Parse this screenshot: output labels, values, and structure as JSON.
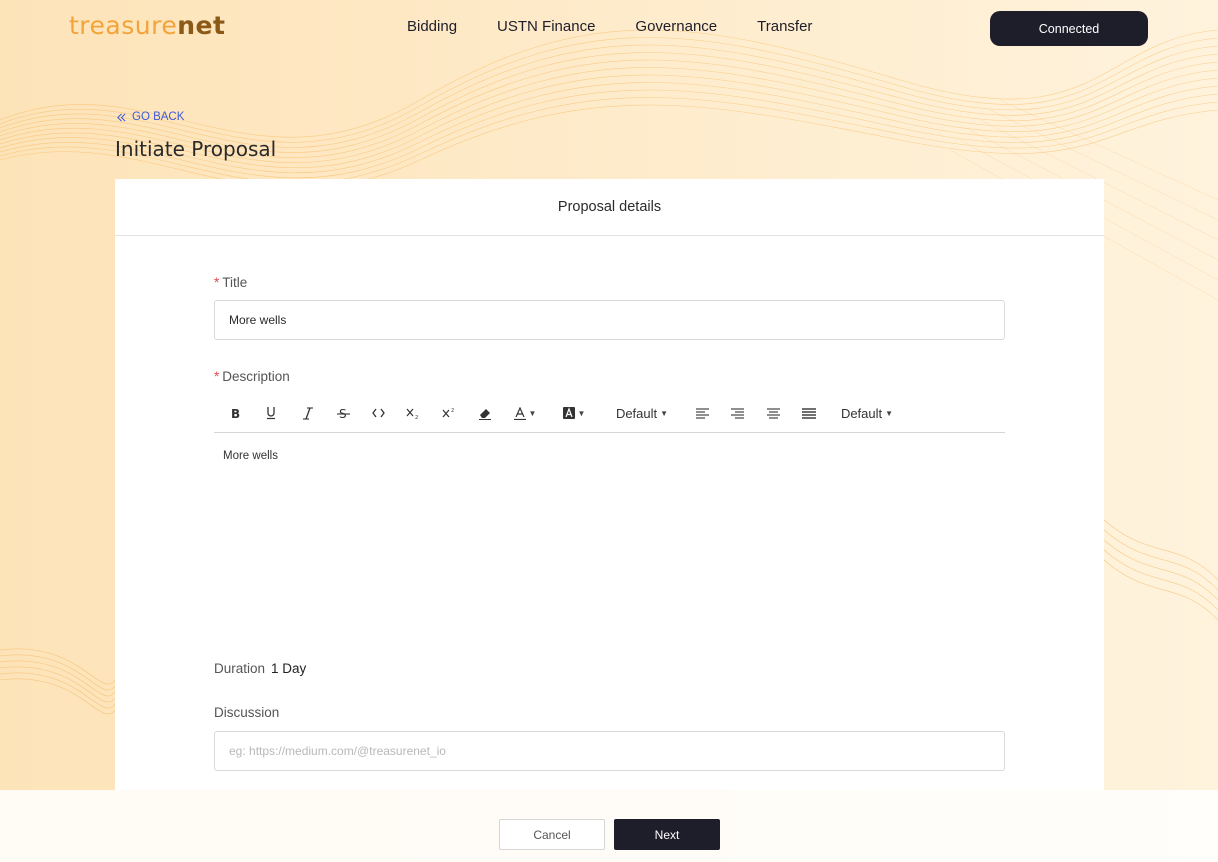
{
  "header": {
    "logo_light": "treasure",
    "logo_dark": "net",
    "nav": [
      "Bidding",
      "USTN Finance",
      "Governance",
      "Transfer"
    ],
    "connect_label": "Connected"
  },
  "page": {
    "back_label": "GO BACK",
    "title": "Initiate Proposal"
  },
  "card": {
    "heading": "Proposal details",
    "title_label": "Title",
    "title_value": "More wells",
    "description_label": "Description",
    "toolbar": {
      "font_size": "Default",
      "line_height": "Default",
      "tools": [
        "bold-icon",
        "underline-icon",
        "italic-icon",
        "strikethrough-icon",
        "code-icon",
        "subscript-icon",
        "superscript-icon",
        "eraser-icon",
        "text-color-icon",
        "highlight-icon",
        "align-left-icon",
        "align-right-icon",
        "align-center-icon",
        "align-justify-icon"
      ]
    },
    "description_value": "More wells",
    "duration_label": "Duration",
    "duration_value": "1 Day",
    "discussion_label": "Discussion",
    "discussion_placeholder": "eg: https://medium.com/@treasurenet_io"
  },
  "actions": {
    "cancel_label": "Cancel",
    "next_label": "Next"
  },
  "colors": {
    "accent": "#1e1d2a",
    "brand": "#f2a43a",
    "link": "#3b5bdb",
    "required": "#e5484d"
  }
}
